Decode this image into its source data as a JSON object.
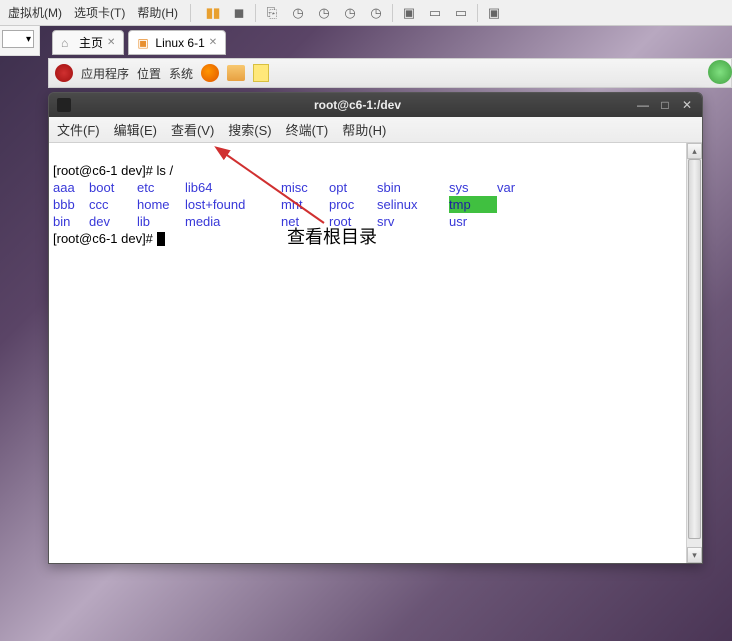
{
  "vm_menu": {
    "machine": "虚拟机(M)",
    "tabs": "选项卡(T)",
    "help": "帮助(H)"
  },
  "tabs": {
    "home": "主页",
    "linux": "Linux 6-1"
  },
  "gnome": {
    "applications": "应用程序",
    "places": "位置",
    "system": "系统"
  },
  "terminal": {
    "title": "root@c6-1:/dev",
    "menu": {
      "file": "文件(F)",
      "edit": "编辑(E)",
      "view": "查看(V)",
      "search": "搜索(S)",
      "terminal": "终端(T)",
      "help": "帮助(H)"
    },
    "prompt1": "[root@c6-1 dev]# ",
    "cmd1": "ls /",
    "prompt2": "[root@c6-1 dev]# ",
    "ls": {
      "c1": [
        "aaa",
        "bbb",
        "bin"
      ],
      "c2": [
        "boot",
        "ccc",
        "dev"
      ],
      "c3": [
        "etc",
        "home",
        "lib"
      ],
      "c4": [
        "lib64",
        "lost+found",
        "media"
      ],
      "c5": [
        "misc",
        "mnt",
        "net"
      ],
      "c6": [
        "opt",
        "proc",
        "root"
      ],
      "c7": [
        "sbin",
        "selinux",
        "srv"
      ],
      "c8_0": "sys",
      "c8_1": "tmp",
      "c8_2": "usr",
      "c9": [
        "var"
      ]
    }
  },
  "annotation": "查看根目录"
}
